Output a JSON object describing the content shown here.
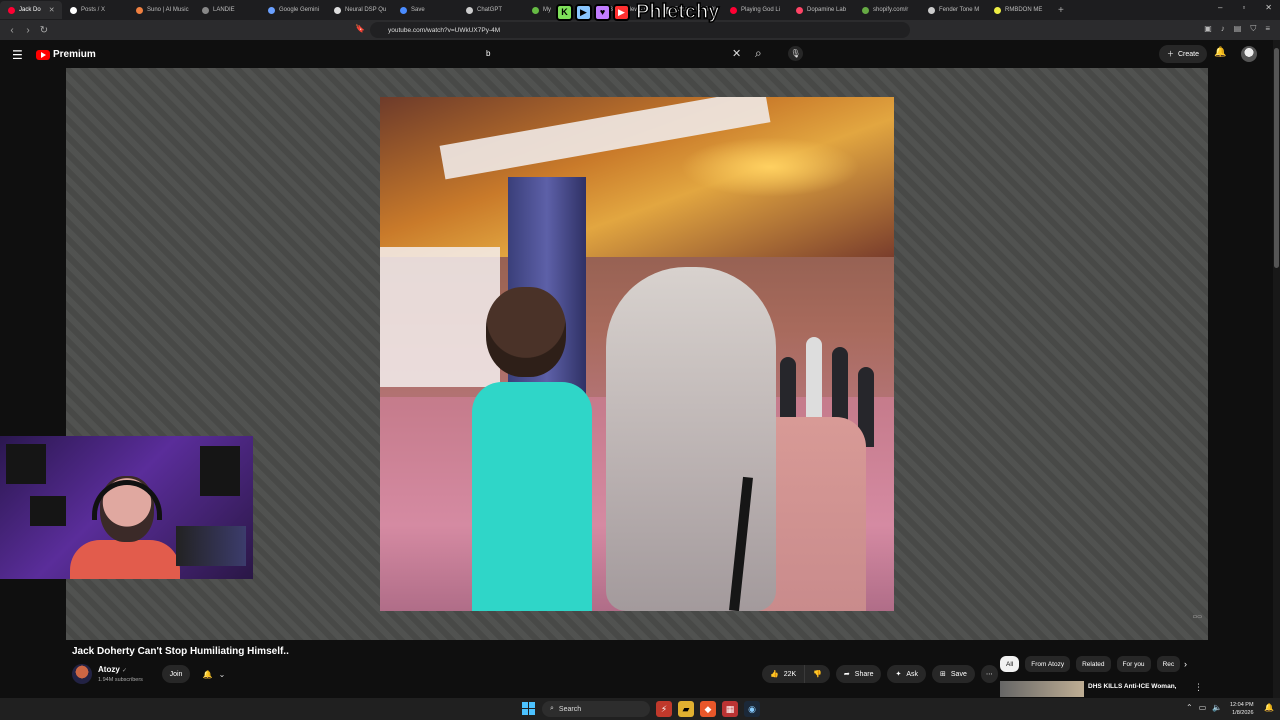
{
  "browser": {
    "tabs": [
      {
        "label": "Jack Do",
        "color": "#ff0033",
        "active": true
      },
      {
        "label": "Posts / X",
        "color": "#ffffff",
        "active": false
      },
      {
        "label": "Suno | AI Music",
        "color": "#f08040",
        "active": false
      },
      {
        "label": "LANDIE",
        "color": "#888888",
        "active": false
      },
      {
        "label": "Google Gemini",
        "color": "#6aa0ff",
        "active": false
      },
      {
        "label": "Neural DSP Qu",
        "color": "#dddddd",
        "active": false
      },
      {
        "label": "Save",
        "color": "#4a8cff",
        "active": false
      },
      {
        "label": "ChatGPT",
        "color": "#cccccc",
        "active": false
      },
      {
        "label": "My",
        "color": "#66bb44",
        "active": false
      },
      {
        "label": "Brand New - B",
        "color": "#6a6aff",
        "active": false
      },
      {
        "label": "Romeo UKITOK",
        "color": "#cccccc",
        "active": false
      },
      {
        "label": "Playing God Li",
        "color": "#ff0033",
        "active": false
      },
      {
        "label": "Dopamine Lab",
        "color": "#ff4466",
        "active": false
      },
      {
        "label": "shopify.com/r",
        "color": "#66aa44",
        "active": false
      },
      {
        "label": "Fender Tone M",
        "color": "#cccccc",
        "active": false
      },
      {
        "label": "RMBDON ME",
        "color": "#eeee44",
        "active": false
      }
    ],
    "new_tab": "+",
    "window_controls": [
      "–",
      "▫",
      "✕"
    ],
    "url": "youtube.com/watch?v=UWkUX7Py-4M",
    "brand_overlay": {
      "letters": [
        "K",
        "▶",
        "♥"
      ],
      "name": "Phletchy"
    }
  },
  "youtube": {
    "logo_text": "Premium",
    "search_query": "b",
    "create_label": "Create",
    "video": {
      "title": "Jack Doherty Can't Stop Humiliating Himself..",
      "channel": "Atozy",
      "subscribers": "1.94M subscribers",
      "join_label": "Join",
      "likes": "22K",
      "share_label": "Share",
      "ask_label": "Ask",
      "save_label": "Save"
    },
    "chips": [
      {
        "label": "All",
        "selected": true
      },
      {
        "label": "From Atozy",
        "selected": false
      },
      {
        "label": "Related",
        "selected": false
      },
      {
        "label": "For you",
        "selected": false
      },
      {
        "label": "Rec",
        "selected": false
      }
    ],
    "recommendation": {
      "title": "DHS KILLS Anti-ICE Woman,"
    }
  },
  "taskbar": {
    "search_label": "Search",
    "time": "12:04 PM",
    "date": "1/8/2026"
  },
  "colors": {
    "accent": "#ff0000",
    "background": "#0f0f0f",
    "chip_selected": "#f1f1f1"
  }
}
